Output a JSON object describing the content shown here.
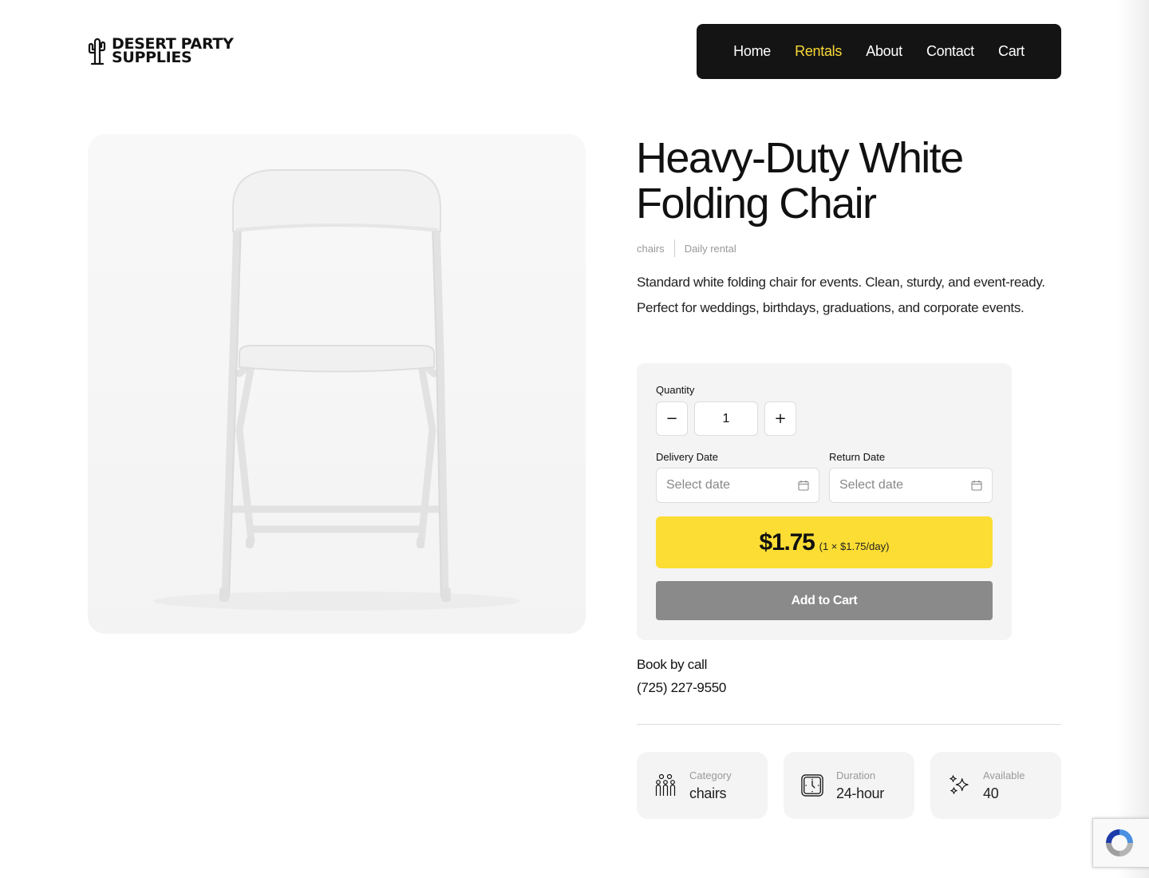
{
  "brand": {
    "name_line1": "DESERT PARTY",
    "name_line2": "SUPPLIES"
  },
  "nav": {
    "items": [
      {
        "label": "Home",
        "active": false
      },
      {
        "label": "Rentals",
        "active": true
      },
      {
        "label": "About",
        "active": false
      },
      {
        "label": "Contact",
        "active": false
      },
      {
        "label": "Cart",
        "active": false
      }
    ],
    "active_color": "#f9d937"
  },
  "product": {
    "title": "Heavy-Duty White Folding Chair",
    "category": "chairs",
    "rental_type": "Daily rental",
    "description": "Standard white folding chair for events. Clean, sturdy, and event-ready. Perfect for weddings, birthdays, graduations, and corporate events.",
    "image_icon": "white-folding-chair-photo"
  },
  "booking": {
    "quantity_label": "Quantity",
    "decrement_label": "−",
    "increment_label": "+",
    "quantity_value": "1",
    "delivery_label": "Delivery Date",
    "delivery_placeholder": "Select date",
    "return_label": "Return Date",
    "return_placeholder": "Select date",
    "price": "$1.75",
    "price_breakdown": "(1 × $1.75/day)",
    "add_to_cart": "Add to Cart",
    "accent_color": "#fcdd33"
  },
  "call": {
    "label": "Book by call",
    "phone": "(725) 227-9550"
  },
  "stats": [
    {
      "label": "Category",
      "value": "chairs",
      "icon": "people-icon"
    },
    {
      "label": "Duration",
      "value": "24-hour",
      "icon": "clock-icon"
    },
    {
      "label": "Available",
      "value": "40",
      "icon": "sparkle-icon"
    }
  ]
}
